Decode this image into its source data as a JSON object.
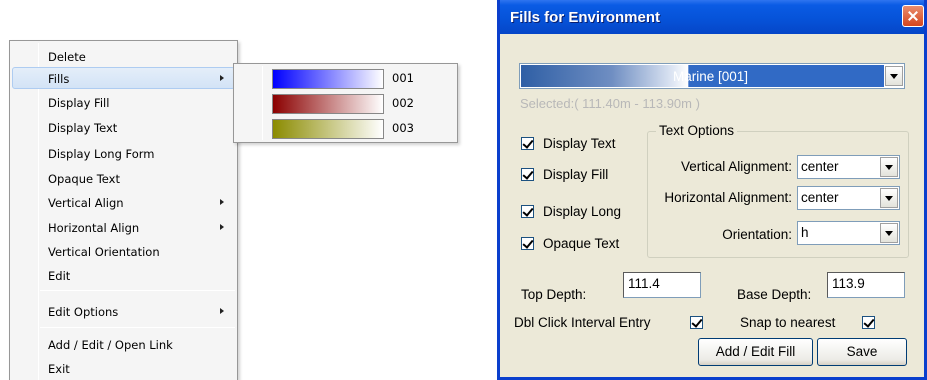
{
  "context_menu": {
    "items": [
      {
        "label": "Delete"
      },
      {
        "label": "Fills"
      },
      {
        "label": "Display Fill"
      },
      {
        "label": "Display Text"
      },
      {
        "label": "Display Long Form"
      },
      {
        "label": "Opaque Text"
      },
      {
        "label": "Vertical Align"
      },
      {
        "label": "Horizontal Align"
      },
      {
        "label": "Vertical Orientation"
      },
      {
        "label": "Edit"
      },
      {
        "label": "Edit Options"
      },
      {
        "label": "Add / Edit / Open Link"
      },
      {
        "label": "Exit"
      }
    ],
    "highlighted_item": "Fills",
    "highlight_color": "#d3e3f6"
  },
  "fills_submenu": {
    "items": [
      {
        "label": "001",
        "gradient_color": "#0000ff"
      },
      {
        "label": "002",
        "gradient_color": "#8b0000"
      },
      {
        "label": "003",
        "gradient_color": "#8b8b00"
      }
    ]
  },
  "dialog": {
    "title": "Fills for Environment",
    "titlebar_color": "#0653d9",
    "fill_selector": {
      "value": "Marine [001]"
    },
    "selected_range": "Selected:( 111.40m - 113.90m )",
    "checkboxes": [
      {
        "label": "Display Text",
        "checked": true
      },
      {
        "label": "Display Fill",
        "checked": true
      },
      {
        "label": "Display Long",
        "checked": true
      },
      {
        "label": "Opaque Text",
        "checked": true
      }
    ],
    "text_options": {
      "title": "Text Options",
      "vertical_alignment": {
        "label": "Vertical Alignment:",
        "value": "center"
      },
      "horizontal_alignment": {
        "label": "Horizontal Alignment:",
        "value": "center"
      },
      "orientation": {
        "label": "Orientation:",
        "value": "h"
      }
    },
    "top_depth": {
      "label": "Top Depth:",
      "value": "111.4"
    },
    "base_depth": {
      "label": "Base Depth:",
      "value": "113.9"
    },
    "dbl_click": {
      "label": "Dbl Click Interval Entry",
      "checked": true
    },
    "snap": {
      "label": "Snap to nearest",
      "checked": true
    },
    "buttons": {
      "add_edit_fill": "Add / Edit Fill",
      "save": "Save"
    }
  }
}
